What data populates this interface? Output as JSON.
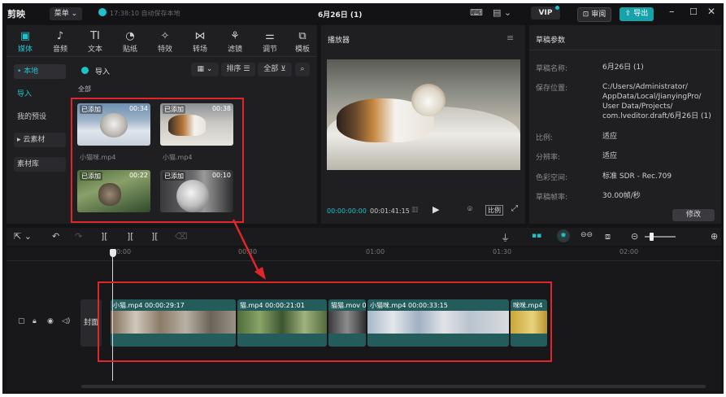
{
  "titlebar": {
    "logo": "剪映",
    "menu": "菜单",
    "autosave": "17:38:10 自动保存本地",
    "project_title": "6月26日 (1)",
    "vip": "VIP",
    "review": "审阅",
    "export": "导出",
    "colors": {
      "accent": "#1fc2c9",
      "export_bg": "#16a2a8"
    }
  },
  "toolbar": {
    "tools": [
      {
        "label": "媒体",
        "icon": "media-icon",
        "glyph": "▣"
      },
      {
        "label": "音频",
        "icon": "audio-icon",
        "glyph": "♪"
      },
      {
        "label": "文本",
        "icon": "text-icon",
        "glyph": "TI"
      },
      {
        "label": "贴纸",
        "icon": "sticker-icon",
        "glyph": "◔"
      },
      {
        "label": "特效",
        "icon": "effects-icon",
        "glyph": "✧"
      },
      {
        "label": "转场",
        "icon": "transition-icon",
        "glyph": "⋈"
      },
      {
        "label": "滤镜",
        "icon": "filter-icon",
        "glyph": "⚘"
      },
      {
        "label": "调节",
        "icon": "adjust-icon",
        "glyph": "⚌"
      },
      {
        "label": "模板",
        "icon": "template-icon",
        "glyph": "⧉"
      }
    ]
  },
  "media": {
    "sidebar": [
      "• 本地",
      "导入",
      "我的预设",
      "▸ 云素材",
      "素材库"
    ],
    "import_label": "导入",
    "sort_label": "排序",
    "all_label": "全部",
    "section_label": "全部",
    "items": [
      {
        "badge": "已添加",
        "duration": "00:34",
        "name": "小猫咪.mp4"
      },
      {
        "badge": "已添加",
        "duration": "00:38",
        "name": "小猫.mp4"
      },
      {
        "badge": "已添加",
        "duration": "00:22",
        "name": ""
      },
      {
        "badge": "已添加",
        "duration": "00:10",
        "name": ""
      }
    ]
  },
  "player": {
    "title": "播放器",
    "current_time": "00:00:00:00",
    "total_time": "00:01:41:15",
    "ratio": "比例"
  },
  "draft": {
    "title": "草稿参数",
    "params": [
      {
        "key": "草稿名称:",
        "value": "6月26日 (1)"
      },
      {
        "key": "保存位置:",
        "value": "C:/Users/Administrator/ AppData/Local/JianyingPro/ User Data/Projects/ com.lveditor.draft/6月26日 (1)"
      },
      {
        "key": "比例:",
        "value": "适应"
      },
      {
        "key": "分辨率:",
        "value": "适应"
      },
      {
        "key": "色彩空间:",
        "value": "标准 SDR - Rec.709"
      },
      {
        "key": "草稿帧率:",
        "value": "30.00帧/秒"
      }
    ],
    "modify": "修改"
  },
  "timeline": {
    "ruler": [
      "00:00",
      "00:30",
      "01:00",
      "01:30",
      "02:00"
    ],
    "cover": "封面",
    "clips": [
      {
        "label": "小猫.mp4  00:00:29:17",
        "color": "#2b6b6b"
      },
      {
        "label": "猫.mp4  00:00:21:01",
        "color": "#2b6b6b"
      },
      {
        "label": "猫猫.mov  0",
        "color": "#2b6b6b"
      },
      {
        "label": "小猫咪.mp4  00:00:33:15",
        "color": "#2b6b6b"
      },
      {
        "label": "咪咪.mp4",
        "color": "#2b6b6b"
      }
    ]
  }
}
